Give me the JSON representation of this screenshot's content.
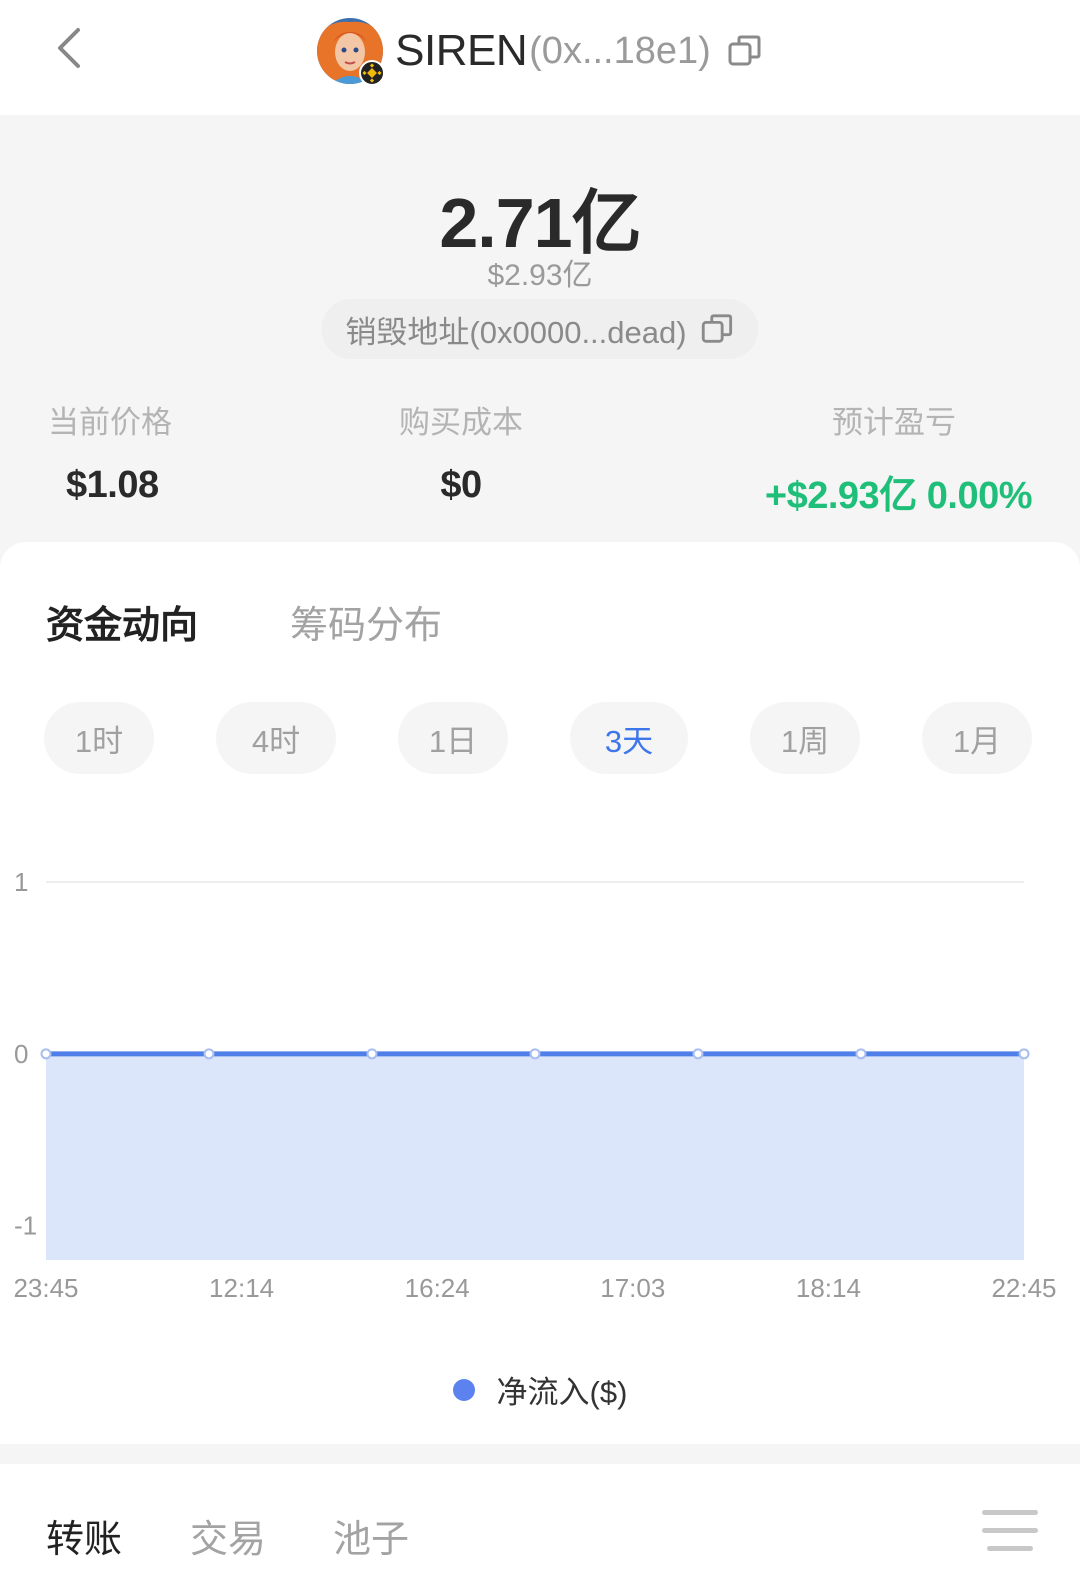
{
  "header": {
    "token_name": "SIREN",
    "token_address": "(0x...18e1)"
  },
  "hero": {
    "amount": "2.71亿",
    "amount_usd": "$2.93亿",
    "burn_address": "销毁地址(0x0000...dead)"
  },
  "stats": [
    {
      "label": "当前价格",
      "value": "$1.08"
    },
    {
      "label": "购买成本",
      "value": "$0"
    },
    {
      "label": "预计盈亏",
      "value": "+$2.93亿 0.00%"
    }
  ],
  "tabs": [
    {
      "label": "资金动向",
      "active": true
    },
    {
      "label": "筹码分布",
      "active": false
    }
  ],
  "ranges": [
    {
      "label": "1时",
      "selected": false
    },
    {
      "label": "4时",
      "selected": false
    },
    {
      "label": "1日",
      "selected": false
    },
    {
      "label": "3天",
      "selected": true
    },
    {
      "label": "1周",
      "selected": false
    },
    {
      "label": "1月",
      "selected": false
    }
  ],
  "colors": {
    "accent": "#3d76ea",
    "line": "#4f7fe8",
    "area": "#dbe6fb",
    "positive": "#1fbf7a"
  },
  "chart_data": {
    "type": "area",
    "x": [
      "23:45",
      "12:14",
      "16:24",
      "17:03",
      "18:14",
      "22:45"
    ],
    "series": [
      {
        "name": "净流入($)",
        "values": [
          0,
          0,
          0,
          0,
          0,
          0,
          0
        ]
      }
    ],
    "y_ticks": [
      "1",
      "0",
      "-1"
    ],
    "ylim": [
      -1.2,
      1
    ],
    "grid": true,
    "legend": "bottom-center"
  },
  "bottom_tabs": [
    {
      "label": "转账",
      "active": true
    },
    {
      "label": "交易",
      "active": false
    },
    {
      "label": "池子",
      "active": false
    }
  ]
}
